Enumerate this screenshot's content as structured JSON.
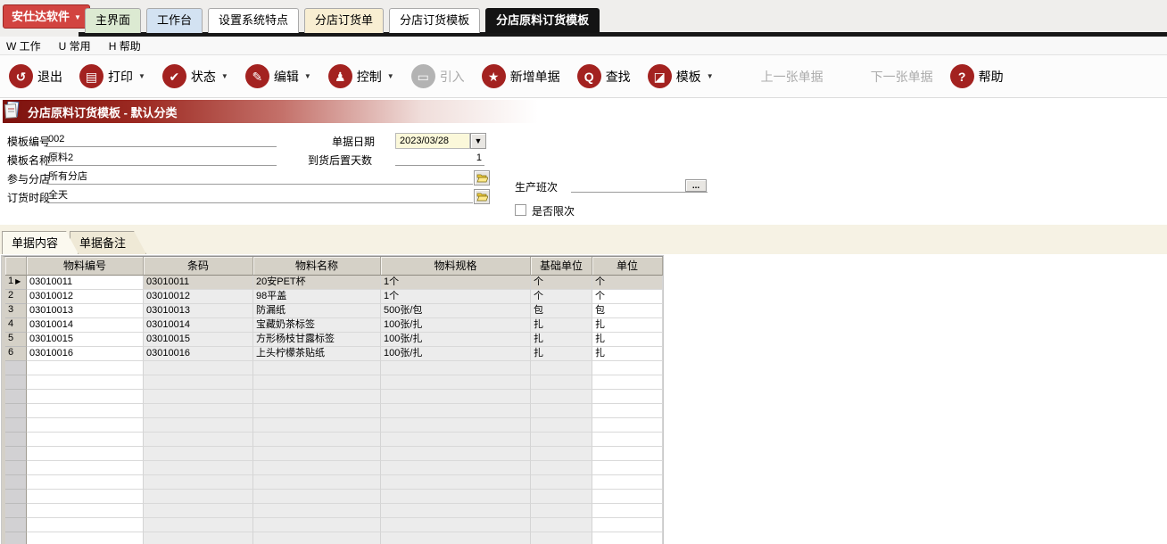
{
  "header": {
    "brand": "安仕达软件",
    "tabs": [
      {
        "label": "主界面",
        "bg": "#dcead2",
        "active": false
      },
      {
        "label": "工作台",
        "bg": "#d3e2f2",
        "active": false
      },
      {
        "label": "设置系统特点",
        "bg": "#ffffff",
        "active": false
      },
      {
        "label": "分店订货单",
        "bg": "#f8eed2",
        "active": false
      },
      {
        "label": "分店订货模板",
        "bg": "#ffffff",
        "active": false
      },
      {
        "label": "分店原料订货模板",
        "bg": "#141414",
        "active": true
      }
    ]
  },
  "menubar": {
    "items": [
      {
        "hotkey": "W",
        "label": "工作"
      },
      {
        "hotkey": "U",
        "label": "常用"
      },
      {
        "hotkey": "H",
        "label": "帮助"
      }
    ]
  },
  "toolbar": {
    "items": [
      {
        "label": "退出",
        "icon": "undo-arrow-icon",
        "glyph": "↺",
        "dropdown": false,
        "disabled": false,
        "textonly": false
      },
      {
        "label": "打印",
        "icon": "printer-icon",
        "glyph": "▤",
        "dropdown": true,
        "disabled": false,
        "textonly": false
      },
      {
        "label": "状态",
        "icon": "check-icon",
        "glyph": "✔",
        "dropdown": true,
        "disabled": false,
        "textonly": false
      },
      {
        "label": "编辑",
        "icon": "pencil-icon",
        "glyph": "✎",
        "dropdown": true,
        "disabled": false,
        "textonly": false
      },
      {
        "label": "控制",
        "icon": "person-icon",
        "glyph": "♟",
        "dropdown": true,
        "disabled": false,
        "textonly": false
      },
      {
        "label": "引入",
        "icon": "folder-icon",
        "glyph": "▭",
        "dropdown": false,
        "disabled": true,
        "textonly": false
      },
      {
        "label": "新增单据",
        "icon": "star-icon",
        "glyph": "★",
        "dropdown": false,
        "disabled": false,
        "textonly": false
      },
      {
        "label": "查找",
        "icon": "search-icon",
        "glyph": "Q",
        "dropdown": false,
        "disabled": false,
        "textonly": false
      },
      {
        "label": "模板",
        "icon": "template-icon",
        "glyph": "◪",
        "dropdown": true,
        "disabled": false,
        "textonly": false
      },
      {
        "label": "上一张单据",
        "icon": "",
        "glyph": "",
        "dropdown": false,
        "disabled": true,
        "textonly": true
      },
      {
        "label": "下一张单据",
        "icon": "",
        "glyph": "",
        "dropdown": false,
        "disabled": true,
        "textonly": true
      },
      {
        "label": "帮助",
        "icon": "help-icon",
        "glyph": "?",
        "dropdown": false,
        "disabled": false,
        "textonly": false
      }
    ]
  },
  "title_bar": {
    "text": "分店原料订货模板 - 默认分类"
  },
  "form": {
    "template_no": {
      "label": "模板编号",
      "value": "002"
    },
    "template_name": {
      "label": "模板名称",
      "value": "原料2"
    },
    "stores": {
      "label": "参与分店",
      "value": "所有分店"
    },
    "time_slot": {
      "label": "订货时段",
      "value": "全天"
    },
    "doc_date": {
      "label": "单据日期",
      "value": "2023/03/28"
    },
    "arrival_days": {
      "label": "到货后置天数",
      "value": "1"
    },
    "shift": {
      "label": "生产班次",
      "value": "",
      "button": "..."
    },
    "limit_check": {
      "label": "是否限次",
      "checked": false
    }
  },
  "content_tabs": [
    {
      "label": "单据内容",
      "active": true
    },
    {
      "label": "单据备注",
      "active": false
    }
  ],
  "grid": {
    "columns": [
      {
        "key": "rownum",
        "label": "",
        "width": 24,
        "editable": false
      },
      {
        "key": "code",
        "label": "物料编号",
        "width": 131,
        "editable": true
      },
      {
        "key": "barcode",
        "label": "条码",
        "width": 123,
        "editable": false
      },
      {
        "key": "name",
        "label": "物料名称",
        "width": 143,
        "editable": false
      },
      {
        "key": "spec",
        "label": "物料规格",
        "width": 168,
        "editable": false
      },
      {
        "key": "base_unit",
        "label": "基础单位",
        "width": 69,
        "editable": false
      },
      {
        "key": "unit",
        "label": "单位",
        "width": 79,
        "editable": true
      }
    ],
    "rows": [
      {
        "code": "03010011",
        "barcode": "03010011",
        "name": "20安PET杯",
        "spec": "1个",
        "base_unit": "个",
        "unit": "个"
      },
      {
        "code": "03010012",
        "barcode": "03010012",
        "name": "98平盖",
        "spec": "1个",
        "base_unit": "个",
        "unit": "个"
      },
      {
        "code": "03010013",
        "barcode": "03010013",
        "name": "防漏纸",
        "spec": "500张/包",
        "base_unit": "包",
        "unit": "包"
      },
      {
        "code": "03010014",
        "barcode": "03010014",
        "name": "宝藏奶茶标签",
        "spec": "100张/扎",
        "base_unit": "扎",
        "unit": "扎"
      },
      {
        "code": "03010015",
        "barcode": "03010015",
        "name": "方形杨枝甘露标签",
        "spec": "100张/扎",
        "base_unit": "扎",
        "unit": "扎"
      },
      {
        "code": "03010016",
        "barcode": "03010016",
        "name": "上头柠檬茶贴纸",
        "spec": "100张/扎",
        "base_unit": "扎",
        "unit": "扎"
      }
    ],
    "selected_row_index": 0,
    "empty_row_count": 13
  },
  "colors": {
    "brand_red": "#d24440",
    "toolbar_icon_red": "#a32220",
    "title_gradient_dark": "#7d120e",
    "grid_header_bg": "#d5d1c7",
    "grid_readonly_bg": "#ececec",
    "grid_selected_bg": "#d9d5cd",
    "date_field_bg": "#fbf8da",
    "strip_bg": "#f6f2e4",
    "active_tab_bg": "#141414"
  }
}
